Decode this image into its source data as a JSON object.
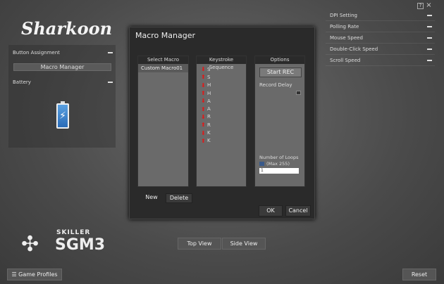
{
  "brand": "Sharkoon",
  "product": {
    "line": "SKILLER",
    "model": "SGM3"
  },
  "window_buttons": {
    "help": "?",
    "close": "×"
  },
  "left": {
    "button_assignment": "Button Assignment",
    "macro_manager": "Macro Manager",
    "battery": "Battery",
    "battery_icon": "charging-battery-icon"
  },
  "right": {
    "items": [
      "DPI Setting",
      "Polling Rate",
      "Mouse Speed",
      "Double-Click Speed",
      "Scroll Speed"
    ]
  },
  "dialog": {
    "title": "Macro Manager",
    "select_macro": {
      "header": "Select Macro",
      "items": [
        "Custom Macro01"
      ]
    },
    "keystrokes": {
      "header": "Keystroke Sequence",
      "items": [
        {
          "key": "S",
          "dir": "down"
        },
        {
          "key": "S",
          "dir": "up"
        },
        {
          "key": "H",
          "dir": "down"
        },
        {
          "key": "H",
          "dir": "up"
        },
        {
          "key": "A",
          "dir": "down"
        },
        {
          "key": "A",
          "dir": "up"
        },
        {
          "key": "R",
          "dir": "down"
        },
        {
          "key": "R",
          "dir": "up"
        },
        {
          "key": "K",
          "dir": "down"
        },
        {
          "key": "K",
          "dir": "up"
        }
      ]
    },
    "options": {
      "header": "Options",
      "start_rec": "Start REC",
      "record_delay": "Record Delay",
      "loops_label": "Number of Loops",
      "max_label": "(Max 255)",
      "loops_value": "1"
    },
    "new": "New",
    "delete": "Delete",
    "ok": "OK",
    "cancel": "Cancel"
  },
  "views": {
    "top": "Top View",
    "side": "Side View"
  },
  "footer": {
    "game_profiles": "Game Profiles",
    "reset": "Reset"
  }
}
